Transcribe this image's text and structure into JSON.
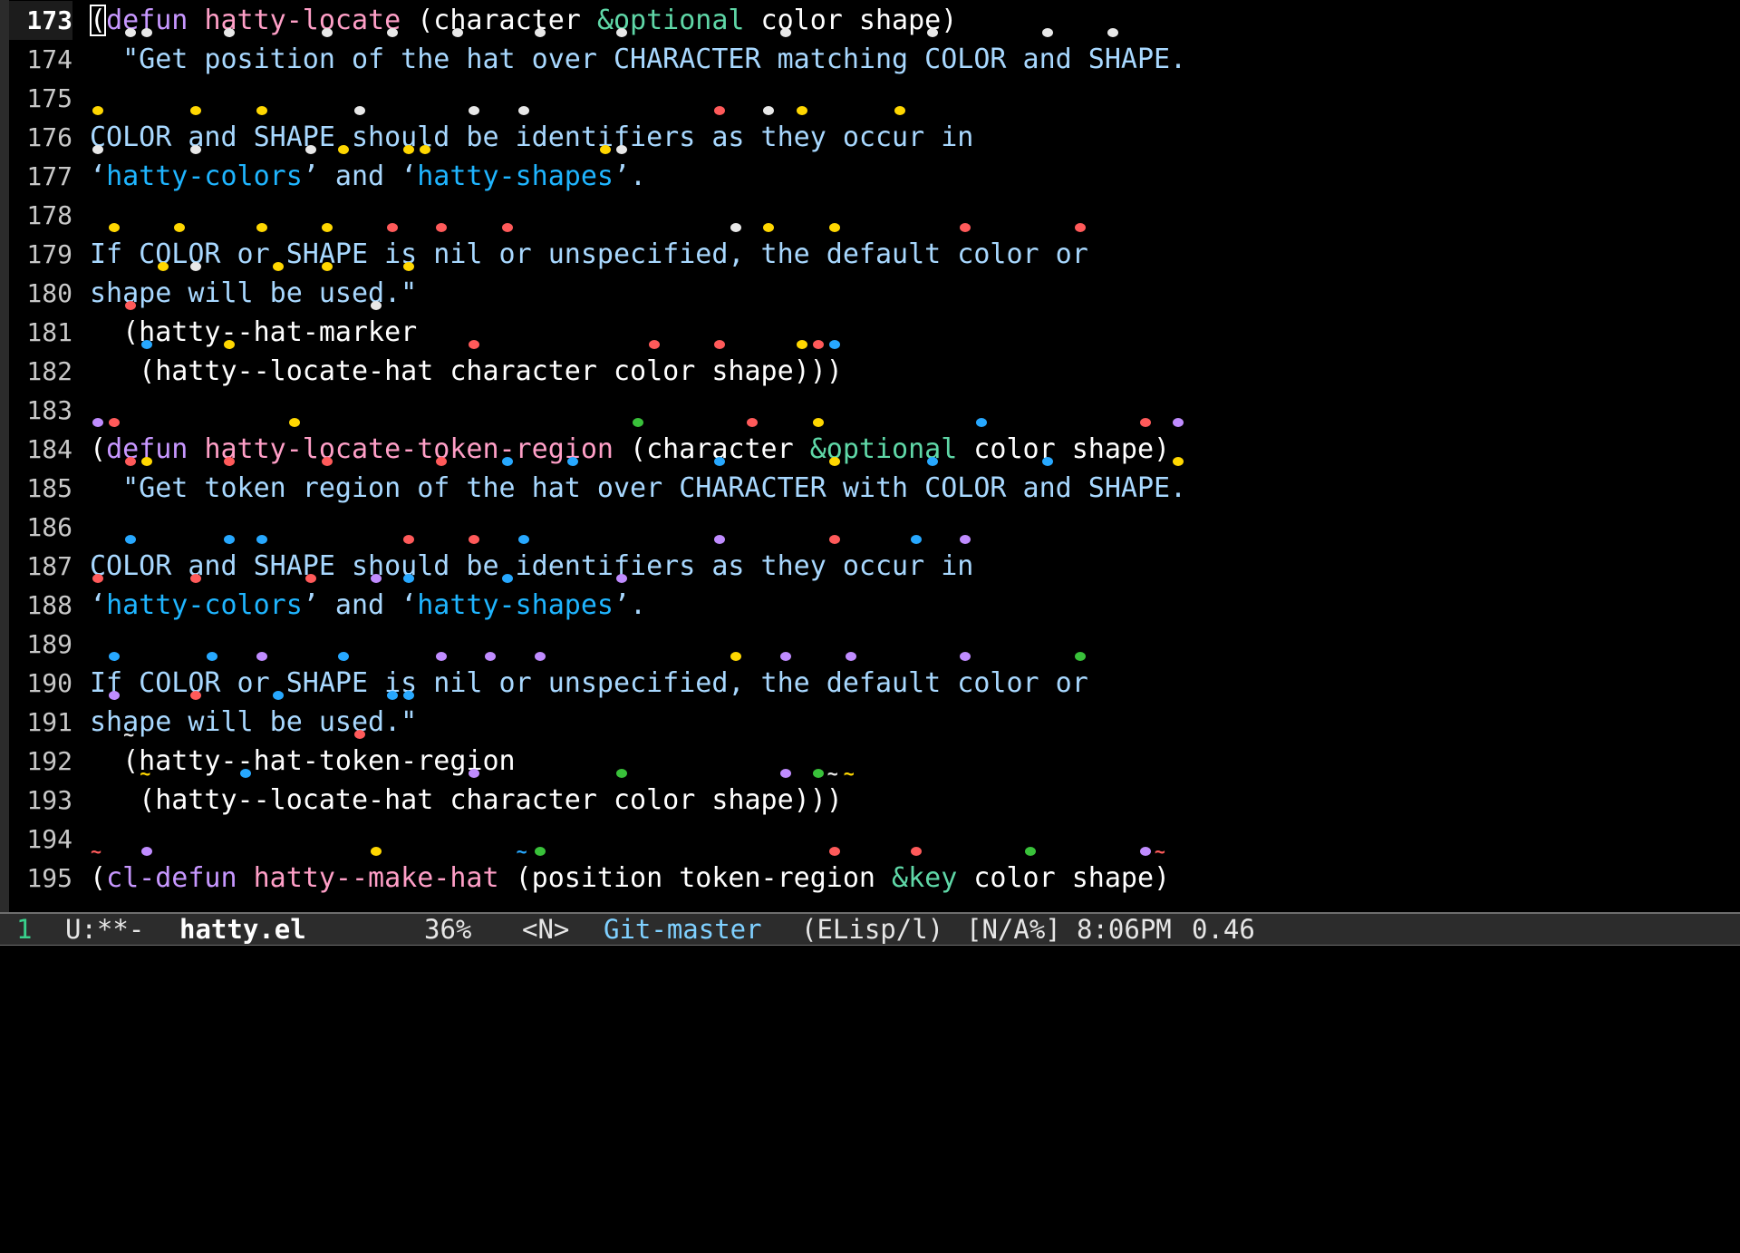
{
  "colors": {
    "background": "#000000",
    "keyword": "#c797ff",
    "function_name": "#ff9fc7",
    "type": "#5fd7a7",
    "docstring": "#a8d8ff",
    "symbol_reference": "#1fb5ff",
    "hat_default": "#e8e8e8",
    "hat_yellow": "#ffd700",
    "hat_red": "#ff5a5a",
    "hat_blue": "#27a8ff",
    "hat_pink": "#c08cff",
    "hat_green": "#39c13a"
  },
  "editor": {
    "lines": [
      {
        "num": "173",
        "current": true,
        "segments": [
          {
            "cls": "paren cursor",
            "text": "("
          },
          {
            "cls": "kw",
            "text": "defun"
          },
          {
            "cls": "arg",
            "text": " "
          },
          {
            "cls": "fn",
            "text": "hatty-locate"
          },
          {
            "cls": "arg",
            "text": " (character "
          },
          {
            "cls": "type",
            "text": "&optional"
          },
          {
            "cls": "arg",
            "text": " color shape)"
          }
        ]
      },
      {
        "num": "174",
        "segments": [
          {
            "cls": "str",
            "text": "  \"Get position of the hat over CHARACTER matching COLOR and SHAPE."
          }
        ]
      },
      {
        "num": "175",
        "segments": []
      },
      {
        "num": "176",
        "segments": [
          {
            "cls": "str",
            "text": "COLOR and SHAPE should be identifiers as they occur in"
          }
        ]
      },
      {
        "num": "177",
        "segments": [
          {
            "cls": "str",
            "text": "‘"
          },
          {
            "cls": "ref",
            "text": "hatty-colors"
          },
          {
            "cls": "str",
            "text": "’ and ‘"
          },
          {
            "cls": "ref",
            "text": "hatty-shapes"
          },
          {
            "cls": "str",
            "text": "’."
          }
        ]
      },
      {
        "num": "178",
        "segments": []
      },
      {
        "num": "179",
        "segments": [
          {
            "cls": "str",
            "text": "If COLOR or SHAPE is nil or unspecified, the default color or"
          }
        ]
      },
      {
        "num": "180",
        "segments": [
          {
            "cls": "str",
            "text": "shape will be used.\""
          }
        ]
      },
      {
        "num": "181",
        "segments": [
          {
            "cls": "arg",
            "text": "  (hatty--hat-marker"
          }
        ]
      },
      {
        "num": "182",
        "segments": [
          {
            "cls": "arg",
            "text": "   (hatty--locate-hat character color shape)))"
          }
        ]
      },
      {
        "num": "183",
        "segments": []
      },
      {
        "num": "184",
        "segments": [
          {
            "cls": "paren",
            "text": "("
          },
          {
            "cls": "kw",
            "text": "defun"
          },
          {
            "cls": "arg",
            "text": " "
          },
          {
            "cls": "fn",
            "text": "hatty-locate-token-region"
          },
          {
            "cls": "arg",
            "text": " (character "
          },
          {
            "cls": "type",
            "text": "&optional"
          },
          {
            "cls": "arg",
            "text": " color shape)"
          }
        ]
      },
      {
        "num": "185",
        "segments": [
          {
            "cls": "str",
            "text": "  \"Get token region of the hat over CHARACTER with COLOR and SHAPE."
          }
        ]
      },
      {
        "num": "186",
        "segments": []
      },
      {
        "num": "187",
        "segments": [
          {
            "cls": "str",
            "text": "COLOR and SHAPE should be identifiers as they occur in"
          }
        ]
      },
      {
        "num": "188",
        "segments": [
          {
            "cls": "str",
            "text": "‘"
          },
          {
            "cls": "ref",
            "text": "hatty-colors"
          },
          {
            "cls": "str",
            "text": "’ and ‘"
          },
          {
            "cls": "ref",
            "text": "hatty-shapes"
          },
          {
            "cls": "str",
            "text": "’."
          }
        ]
      },
      {
        "num": "189",
        "segments": []
      },
      {
        "num": "190",
        "segments": [
          {
            "cls": "str",
            "text": "If COLOR or SHAPE is nil or unspecified, the default color or"
          }
        ]
      },
      {
        "num": "191",
        "segments": [
          {
            "cls": "str",
            "text": "shape will be used.\""
          }
        ]
      },
      {
        "num": "192",
        "segments": [
          {
            "cls": "arg",
            "text": "  (hatty--hat-token-region"
          }
        ]
      },
      {
        "num": "193",
        "segments": [
          {
            "cls": "arg",
            "text": "   (hatty--locate-hat character color shape)))"
          }
        ]
      },
      {
        "num": "194",
        "segments": []
      },
      {
        "num": "195",
        "segments": [
          {
            "cls": "paren",
            "text": "("
          },
          {
            "cls": "kw",
            "text": "cl-defun"
          },
          {
            "cls": "arg",
            "text": " "
          },
          {
            "cls": "fn",
            "text": "hatty--make-hat"
          },
          {
            "cls": "arg",
            "text": " (position token-region "
          },
          {
            "cls": "type",
            "text": "&key"
          },
          {
            "cls": "arg",
            "text": " color shape)"
          }
        ]
      }
    ]
  },
  "hats": [
    {
      "line": 0,
      "col": 0,
      "c": "w"
    },
    {
      "line": 0,
      "col": 1,
      "c": "w"
    },
    {
      "line": 0,
      "col": 7,
      "c": "w"
    },
    {
      "line": 0,
      "col": 13,
      "c": "w"
    },
    {
      "line": 0,
      "col": 20,
      "c": "w"
    },
    {
      "line": 0,
      "col": 26,
      "c": "w"
    },
    {
      "line": 0,
      "col": 31,
      "c": "w"
    },
    {
      "line": 0,
      "col": 41,
      "c": "w"
    },
    {
      "line": 0,
      "col": 47,
      "c": "w"
    },
    {
      "line": 1,
      "col": 2,
      "c": "w"
    },
    {
      "line": 1,
      "col": 3,
      "c": "w"
    },
    {
      "line": 1,
      "col": 8,
      "c": "w"
    },
    {
      "line": 1,
      "col": 14,
      "c": "w"
    },
    {
      "line": 1,
      "col": 18,
      "c": "w"
    },
    {
      "line": 1,
      "col": 22,
      "c": "w"
    },
    {
      "line": 1,
      "col": 27,
      "c": "w"
    },
    {
      "line": 1,
      "col": 32,
      "c": "w"
    },
    {
      "line": 1,
      "col": 42,
      "c": "w"
    },
    {
      "line": 1,
      "col": 51,
      "c": "w"
    },
    {
      "line": 1,
      "col": 58,
      "c": "w"
    },
    {
      "line": 1,
      "col": 62,
      "c": "w"
    },
    {
      "line": 3,
      "col": 0,
      "c": "y"
    },
    {
      "line": 3,
      "col": 6,
      "c": "y"
    },
    {
      "line": 3,
      "col": 10,
      "c": "y"
    },
    {
      "line": 3,
      "col": 16,
      "c": "w"
    },
    {
      "line": 3,
      "col": 23,
      "c": "w"
    },
    {
      "line": 3,
      "col": 26,
      "c": "w"
    },
    {
      "line": 3,
      "col": 38,
      "c": "r"
    },
    {
      "line": 3,
      "col": 41,
      "c": "w"
    },
    {
      "line": 3,
      "col": 43,
      "c": "y"
    },
    {
      "line": 3,
      "col": 49,
      "c": "y"
    },
    {
      "line": 4,
      "col": 0,
      "c": "w"
    },
    {
      "line": 4,
      "col": 6,
      "c": "w"
    },
    {
      "line": 4,
      "col": 13,
      "c": "w"
    },
    {
      "line": 4,
      "col": 15,
      "c": "y"
    },
    {
      "line": 4,
      "col": 19,
      "c": "y"
    },
    {
      "line": 4,
      "col": 20,
      "c": "y"
    },
    {
      "line": 4,
      "col": 31,
      "c": "y"
    },
    {
      "line": 4,
      "col": 32,
      "c": "w"
    },
    {
      "line": 6,
      "col": 1,
      "c": "y"
    },
    {
      "line": 6,
      "col": 5,
      "c": "y"
    },
    {
      "line": 6,
      "col": 10,
      "c": "y"
    },
    {
      "line": 6,
      "col": 14,
      "c": "y"
    },
    {
      "line": 6,
      "col": 18,
      "c": "r"
    },
    {
      "line": 6,
      "col": 21,
      "c": "r"
    },
    {
      "line": 6,
      "col": 25,
      "c": "r"
    },
    {
      "line": 6,
      "col": 39,
      "c": "w"
    },
    {
      "line": 6,
      "col": 41,
      "c": "y"
    },
    {
      "line": 6,
      "col": 45,
      "c": "y"
    },
    {
      "line": 6,
      "col": 53,
      "c": "r"
    },
    {
      "line": 6,
      "col": 60,
      "c": "r"
    },
    {
      "line": 7,
      "col": 4,
      "c": "y"
    },
    {
      "line": 7,
      "col": 6,
      "c": "w"
    },
    {
      "line": 7,
      "col": 11,
      "c": "y"
    },
    {
      "line": 7,
      "col": 14,
      "c": "y"
    },
    {
      "line": 7,
      "col": 19,
      "c": "y"
    },
    {
      "line": 8,
      "col": 2,
      "c": "r"
    },
    {
      "line": 8,
      "col": 17,
      "c": "w"
    },
    {
      "line": 9,
      "col": 3,
      "c": "b"
    },
    {
      "line": 9,
      "col": 8,
      "c": "y"
    },
    {
      "line": 9,
      "col": 23,
      "c": "r"
    },
    {
      "line": 9,
      "col": 34,
      "c": "r"
    },
    {
      "line": 9,
      "col": 38,
      "c": "r"
    },
    {
      "line": 9,
      "col": 43,
      "c": "y"
    },
    {
      "line": 9,
      "col": 44,
      "c": "r"
    },
    {
      "line": 9,
      "col": 45,
      "c": "b"
    },
    {
      "line": 11,
      "col": 0,
      "c": "p"
    },
    {
      "line": 11,
      "col": 1,
      "c": "r"
    },
    {
      "line": 11,
      "col": 12,
      "c": "y"
    },
    {
      "line": 11,
      "col": 33,
      "c": "g"
    },
    {
      "line": 11,
      "col": 40,
      "c": "r"
    },
    {
      "line": 11,
      "col": 44,
      "c": "y"
    },
    {
      "line": 11,
      "col": 54,
      "c": "b"
    },
    {
      "line": 11,
      "col": 64,
      "c": "r"
    },
    {
      "line": 11,
      "col": 66,
      "c": "p"
    },
    {
      "line": 12,
      "col": 2,
      "c": "r"
    },
    {
      "line": 12,
      "col": 3,
      "c": "y"
    },
    {
      "line": 12,
      "col": 8,
      "c": "r"
    },
    {
      "line": 12,
      "col": 14,
      "c": "r"
    },
    {
      "line": 12,
      "col": 21,
      "c": "r"
    },
    {
      "line": 12,
      "col": 25,
      "c": "b"
    },
    {
      "line": 12,
      "col": 29,
      "c": "b"
    },
    {
      "line": 12,
      "col": 38,
      "c": "b"
    },
    {
      "line": 12,
      "col": 45,
      "c": "y"
    },
    {
      "line": 12,
      "col": 51,
      "c": "b"
    },
    {
      "line": 12,
      "col": 58,
      "c": "b"
    },
    {
      "line": 12,
      "col": 66,
      "c": "y"
    },
    {
      "line": 14,
      "col": 2,
      "c": "b"
    },
    {
      "line": 14,
      "col": 8,
      "c": "b"
    },
    {
      "line": 14,
      "col": 10,
      "c": "b"
    },
    {
      "line": 14,
      "col": 19,
      "c": "r"
    },
    {
      "line": 14,
      "col": 23,
      "c": "r"
    },
    {
      "line": 14,
      "col": 26,
      "c": "b"
    },
    {
      "line": 14,
      "col": 38,
      "c": "p"
    },
    {
      "line": 14,
      "col": 45,
      "c": "r"
    },
    {
      "line": 14,
      "col": 50,
      "c": "b"
    },
    {
      "line": 14,
      "col": 53,
      "c": "p"
    },
    {
      "line": 15,
      "col": 0,
      "c": "r"
    },
    {
      "line": 15,
      "col": 6,
      "c": "r"
    },
    {
      "line": 15,
      "col": 13,
      "c": "r"
    },
    {
      "line": 15,
      "col": 17,
      "c": "p"
    },
    {
      "line": 15,
      "col": 19,
      "c": "b"
    },
    {
      "line": 15,
      "col": 25,
      "c": "b"
    },
    {
      "line": 15,
      "col": 32,
      "c": "p"
    },
    {
      "line": 17,
      "col": 1,
      "c": "b"
    },
    {
      "line": 17,
      "col": 7,
      "c": "b"
    },
    {
      "line": 17,
      "col": 10,
      "c": "p"
    },
    {
      "line": 17,
      "col": 15,
      "c": "b"
    },
    {
      "line": 17,
      "col": 21,
      "c": "p"
    },
    {
      "line": 17,
      "col": 24,
      "c": "p"
    },
    {
      "line": 17,
      "col": 27,
      "c": "p"
    },
    {
      "line": 17,
      "col": 39,
      "c": "y"
    },
    {
      "line": 17,
      "col": 42,
      "c": "p"
    },
    {
      "line": 17,
      "col": 46,
      "c": "p"
    },
    {
      "line": 17,
      "col": 53,
      "c": "p"
    },
    {
      "line": 17,
      "col": 60,
      "c": "g"
    },
    {
      "line": 18,
      "col": 1,
      "c": "p"
    },
    {
      "line": 18,
      "col": 6,
      "c": "r"
    },
    {
      "line": 18,
      "col": 11,
      "c": "b"
    },
    {
      "line": 18,
      "col": 18,
      "c": "b"
    },
    {
      "line": 18,
      "col": 19,
      "c": "b"
    },
    {
      "line": 19,
      "col": 2,
      "c": "tw"
    },
    {
      "line": 19,
      "col": 16,
      "c": "r"
    },
    {
      "line": 20,
      "col": 3,
      "c": "ty"
    },
    {
      "line": 20,
      "col": 9,
      "c": "b"
    },
    {
      "line": 20,
      "col": 23,
      "c": "p"
    },
    {
      "line": 20,
      "col": 32,
      "c": "g"
    },
    {
      "line": 20,
      "col": 42,
      "c": "p"
    },
    {
      "line": 20,
      "col": 44,
      "c": "g"
    },
    {
      "line": 20,
      "col": 45,
      "c": "tw"
    },
    {
      "line": 20,
      "col": 46,
      "c": "ty"
    },
    {
      "line": 22,
      "col": 0,
      "c": "tr"
    },
    {
      "line": 22,
      "col": 3,
      "c": "p"
    },
    {
      "line": 22,
      "col": 17,
      "c": "y"
    },
    {
      "line": 22,
      "col": 26,
      "c": "tb"
    },
    {
      "line": 22,
      "col": 27,
      "c": "g"
    },
    {
      "line": 22,
      "col": 45,
      "c": "r"
    },
    {
      "line": 22,
      "col": 50,
      "c": "r"
    },
    {
      "line": 22,
      "col": 57,
      "c": "g"
    },
    {
      "line": 22,
      "col": 64,
      "c": "p"
    },
    {
      "line": 22,
      "col": 65,
      "c": "tr"
    }
  ],
  "modeline": {
    "window": "1",
    "flags": "U:**-",
    "buffer": "hatty.el",
    "percent": "36%",
    "state": "<N>",
    "vc": "Git-master",
    "mode": "(ELisp/l)",
    "misc": "[N/A%]",
    "time": "8:06PM",
    "load": "0.46"
  }
}
